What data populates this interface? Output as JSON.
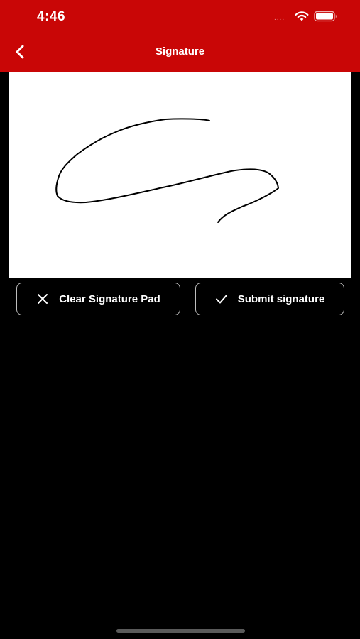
{
  "status_bar": {
    "time": "4:46",
    "dots": "....",
    "icons": [
      "wifi-icon",
      "battery-icon"
    ]
  },
  "nav": {
    "title": "Signature",
    "back_icon": "chevron-left-icon"
  },
  "signature_pad": {
    "has_signature": true
  },
  "actions": {
    "clear_label": "Clear Signature Pad",
    "clear_icon": "close-icon",
    "submit_label": "Submit signature",
    "submit_icon": "checkmark-icon"
  },
  "colors": {
    "header_bg": "#c90606",
    "page_bg": "#000000",
    "pad_bg": "#ffffff",
    "ink": "#000000",
    "button_border": "#bdbdbd",
    "text": "#ffffff"
  }
}
